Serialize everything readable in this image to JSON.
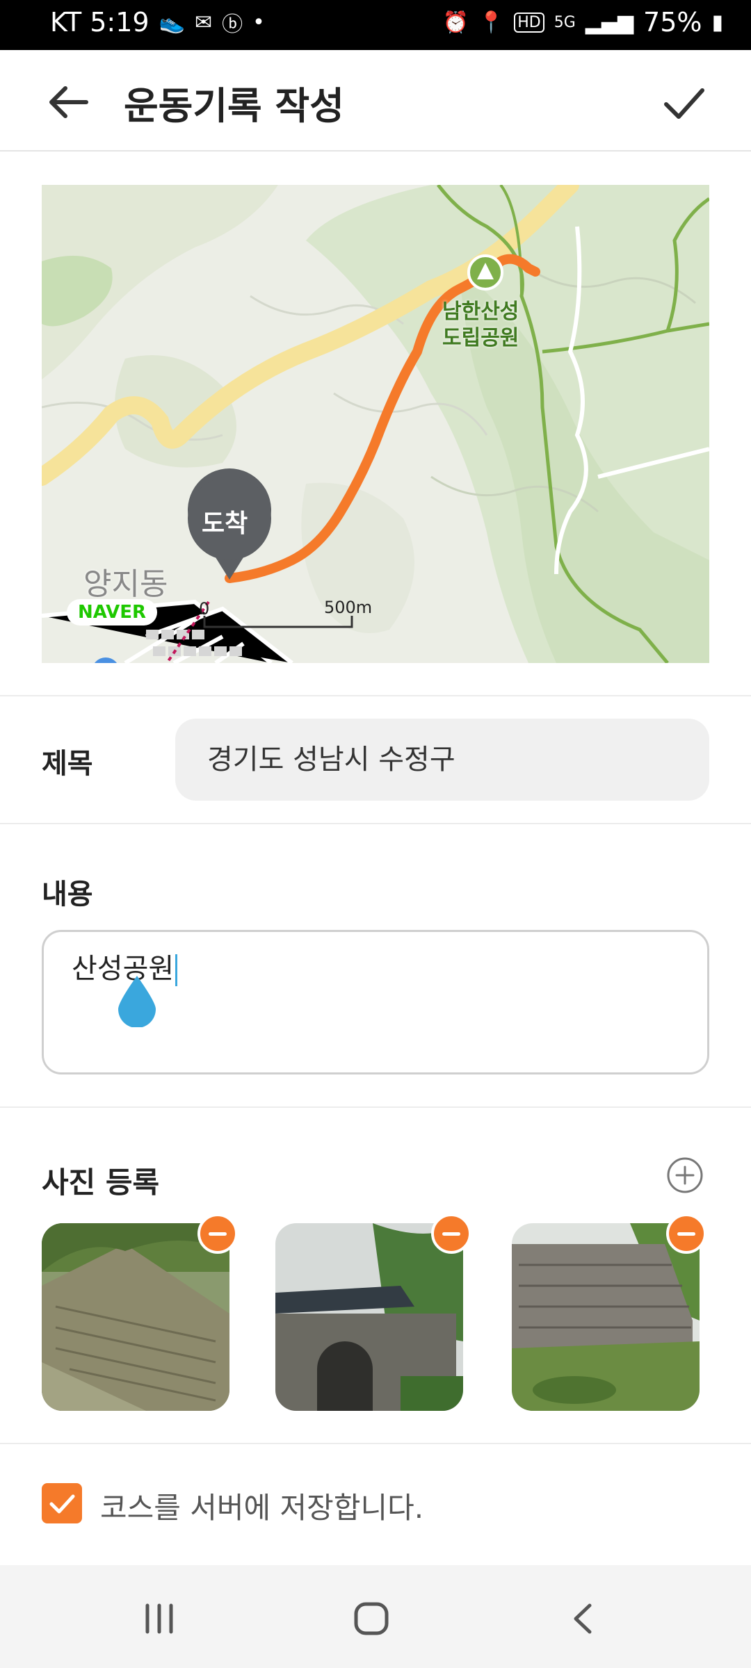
{
  "status_bar": {
    "carrier_time": "KT  5:19",
    "battery": "75%",
    "network": "5G",
    "left_icons": [
      "shoe-icon",
      "mail-icon",
      "b-app-icon",
      "dot-icon"
    ],
    "right_icons": [
      "alarm-icon",
      "location-icon",
      "hd-icon",
      "5g-icon",
      "signal-icon",
      "battery-icon"
    ]
  },
  "app_bar": {
    "title": "운동기록 작성"
  },
  "map": {
    "park_name_line1": "남한산성",
    "park_name_line2": "도립공원",
    "area_name": "양지동",
    "marker_label": "도착",
    "provider": "NAVER",
    "scale_zero": "0",
    "scale_distance": "500m",
    "route_color": "#f57a2a"
  },
  "form": {
    "title_label": "제목",
    "title_value": "경기도 성남시 수정구",
    "content_label": "내용",
    "content_value": "산성공원",
    "photo_label": "사진 등록",
    "save_course_label": "코스를 서버에 저장합니다.",
    "save_course_checked": true
  },
  "colors": {
    "accent": "#f57a2a",
    "caret": "#3aa7dd"
  }
}
